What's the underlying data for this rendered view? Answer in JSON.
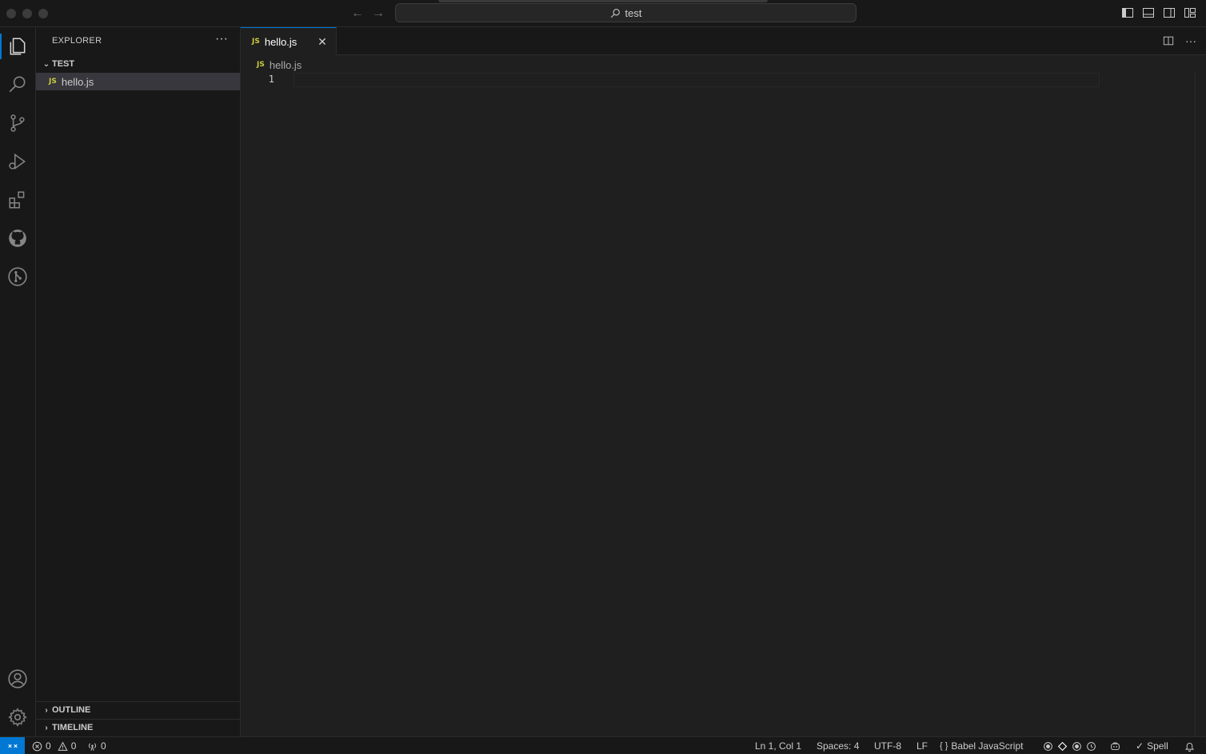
{
  "titlebar": {
    "search_text": "test",
    "nav_back": "←",
    "nav_forward": "→"
  },
  "sidebar": {
    "title": "EXPLORER",
    "more": "···",
    "folder_name": "TEST",
    "files": [
      {
        "badge": "JS",
        "name": "hello.js"
      }
    ],
    "outline": "OUTLINE",
    "timeline": "TIMELINE"
  },
  "editor": {
    "tab": {
      "badge": "JS",
      "label": "hello.js",
      "close": "✕"
    },
    "breadcrumb": {
      "badge": "JS",
      "file": "hello.js"
    },
    "line_number": "1",
    "more": "···"
  },
  "statusbar": {
    "errors": "0",
    "warnings": "0",
    "ports": "0",
    "position": "Ln 1, Col 1",
    "spaces": "Spaces: 4",
    "encoding": "UTF-8",
    "eol": "LF",
    "language": "Babel JavaScript",
    "spell": "Spell"
  },
  "colors": {
    "accent": "#0078d4",
    "js_badge": "#cbcb41",
    "background": "#1f1f1f",
    "panel": "#181818"
  }
}
